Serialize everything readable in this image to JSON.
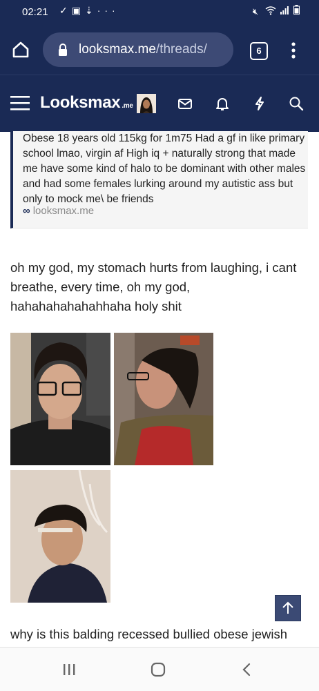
{
  "status_bar": {
    "time": "02:21",
    "left_icons": [
      "checkmark-icon",
      "image-icon",
      "download-icon",
      "more-dots-icon"
    ],
    "right_icons": [
      "mute-icon",
      "wifi-icon",
      "signal-icon",
      "battery-icon"
    ],
    "more_text": "···"
  },
  "browser": {
    "url_domain": "looksmax.me",
    "url_path": "/threads/",
    "tab_count": "6"
  },
  "site": {
    "logo_text": "Looksmax",
    "logo_suffix": ".me"
  },
  "quote": {
    "text": "Obese 18 years old 115kg for 1m75 Had a gf in like primary school lmao, virgin af High iq + naturally strong that made me have some kind of halo to be dominant with other males and had some females lurking around my autistic ass but only to mock me\\ be friends",
    "source": "looksmax.me"
  },
  "post": {
    "text": "oh my god, my stomach hurts from laughing, i cant breathe, every time, oh my god, hahahahahahahhaha holy shit",
    "next_text": "why is this balding recessed bullied obese jewish"
  },
  "colors": {
    "header_bg": "#1a2a55",
    "pill_bg": "#3d4a75",
    "quote_bg": "#f5f5f5"
  }
}
